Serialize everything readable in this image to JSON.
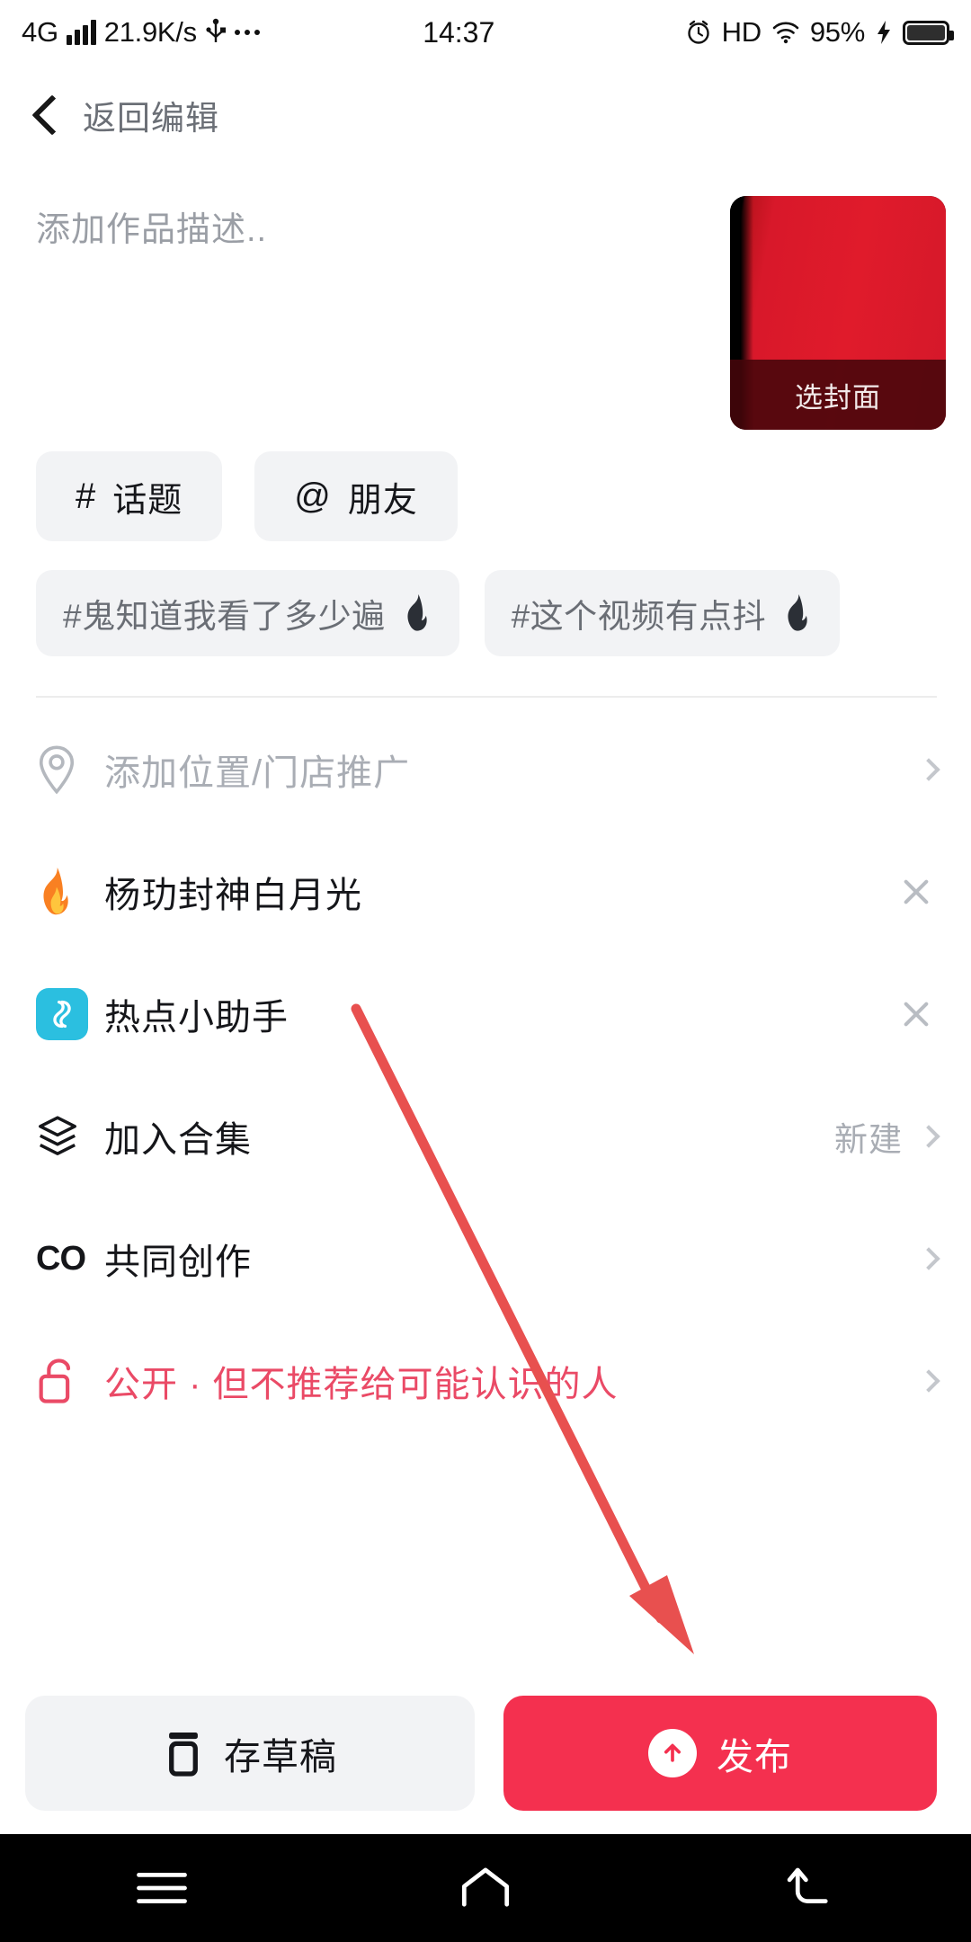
{
  "status_bar": {
    "network_type": "4G",
    "speed": "21.9K/s",
    "usb_icon": "usb-icon",
    "more_icon": "ellipsis-icon",
    "time": "14:37",
    "alarm_icon": "alarm-clock-icon",
    "hd_label": "HD",
    "wifi_icon": "wifi-icon",
    "battery_percent": "95%",
    "charging_icon": "lightning-bolt-icon"
  },
  "navbar": {
    "back_icon": "back-chevron-icon",
    "title": "返回编辑"
  },
  "description": {
    "placeholder": "添加作品描述..",
    "value": ""
  },
  "cover": {
    "label": "选封面"
  },
  "chips": [
    {
      "glyph": "#",
      "label": "话题",
      "name": "topic"
    },
    {
      "glyph": "@",
      "label": "朋友",
      "name": "friend"
    }
  ],
  "tag_suggestions": [
    {
      "label": "#鬼知道我看了多少遍",
      "icon": "flame-icon"
    },
    {
      "label": "#这个视频有点抖",
      "icon": "flame-icon"
    }
  ],
  "rows": [
    {
      "name": "location",
      "icon": "map-pin-icon",
      "label": "添加位置/门店推广",
      "style": "muted",
      "value": "",
      "trailing": "chevron"
    },
    {
      "name": "hot-topic",
      "icon": "flame-color-icon",
      "label": "杨玏封神白月光",
      "style": "normal",
      "value": "",
      "trailing": "close"
    },
    {
      "name": "hotspot-assistant",
      "icon": "hotspot-assistant-icon",
      "label": "热点小助手",
      "style": "normal",
      "value": "",
      "trailing": "close"
    },
    {
      "name": "join-collection",
      "icon": "layers-icon",
      "label": "加入合集",
      "style": "normal",
      "value": "新建",
      "trailing": "chevron"
    },
    {
      "name": "co-creation",
      "icon": "co-icon",
      "label": "共同创作",
      "style": "normal",
      "value": "",
      "trailing": "chevron"
    },
    {
      "name": "privacy",
      "icon": "unlock-icon",
      "label": "公开 · 但不推荐给可能认识的人",
      "style": "pink",
      "value": "",
      "trailing": "chevron"
    }
  ],
  "bottom_bar": {
    "draft_label": "存草稿",
    "draft_icon": "draft-box-icon",
    "publish_label": "发布",
    "publish_icon": "arrow-up-circle-icon"
  },
  "android_nav": {
    "recents_icon": "menu-icon",
    "home_icon": "home-icon",
    "back_icon": "back-arrow-icon"
  },
  "colors": {
    "publish_red": "#f4304f",
    "privacy_pink": "#ea4a66",
    "hotspot_cyan": "#2bbfe0",
    "cover_red": "#dd1b2b",
    "annotation_red": "#e8504f",
    "chip_bg": "#f2f3f5",
    "muted_text": "#a9adb4"
  }
}
